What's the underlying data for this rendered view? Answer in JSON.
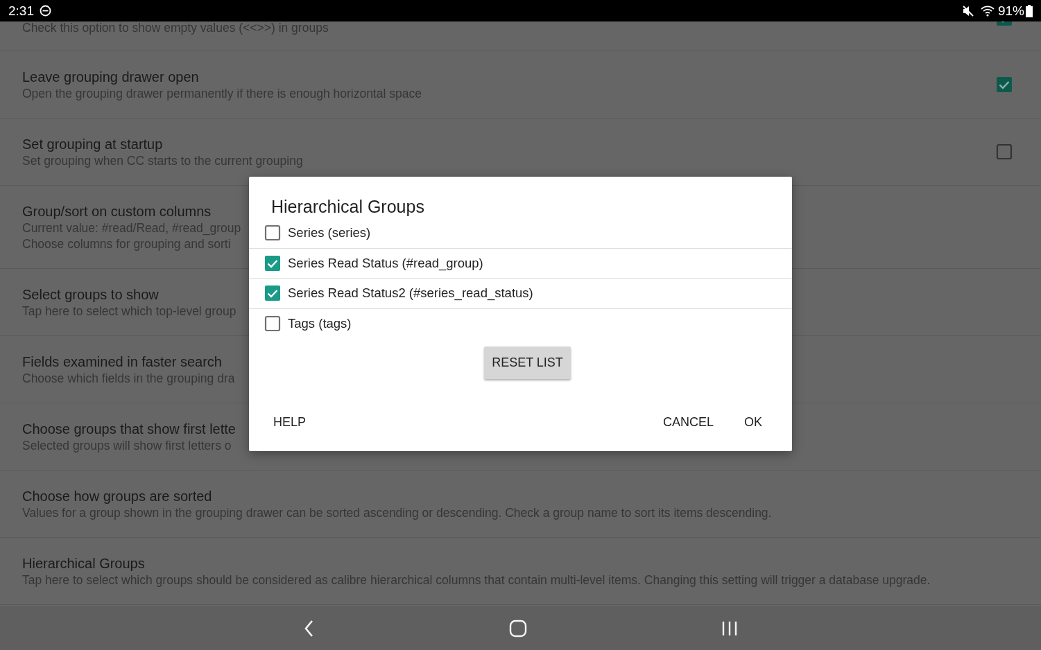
{
  "status_bar": {
    "time": "2:31",
    "battery": "91%"
  },
  "preferences": [
    {
      "kind": "checkbox",
      "summary": "Check this option to show empty values (<<>>) in groups",
      "checked": true
    },
    {
      "kind": "checkbox",
      "title": "Leave grouping drawer open",
      "summary": "Open the grouping drawer permanently if there is enough horizontal space",
      "checked": true
    },
    {
      "kind": "checkbox",
      "title": "Set grouping at startup",
      "summary": "Set grouping when CC starts to the current grouping",
      "checked": false
    },
    {
      "kind": "plain",
      "title": "Group/sort on custom columns",
      "summary": "Current value: #read/Read, #read_group",
      "summary_2": "Choose columns for grouping and sorti"
    },
    {
      "kind": "plain",
      "title": "Select groups to show",
      "summary": "Tap here to select which top-level group"
    },
    {
      "kind": "plain",
      "title": "Fields examined in faster search",
      "summary": "Choose which fields in the grouping dra"
    },
    {
      "kind": "plain",
      "title": "Choose groups that show first lette",
      "summary": "Selected groups will show first letters o"
    },
    {
      "kind": "plain",
      "title": "Choose how groups are sorted",
      "summary": "Values for a group shown in the grouping drawer can be sorted ascending or descending. Check a group name to sort its items descending."
    },
    {
      "kind": "plain",
      "title": "Hierarchical Groups",
      "summary": "Tap here to select which groups should be considered as calibre hierarchical columns that contain multi-level items. Changing this setting will trigger a database upgrade."
    }
  ],
  "dialog": {
    "title": "Hierarchical Groups",
    "items": [
      {
        "label": "Series (series)",
        "checked": false
      },
      {
        "label": "Series Read Status (#read_group)",
        "checked": true
      },
      {
        "label": "Series Read Status2 (#series_read_status)",
        "checked": true
      },
      {
        "label": "Tags (tags)",
        "checked": false
      }
    ],
    "reset_button": "RESET LIST",
    "help_button": "HELP",
    "cancel_button": "CANCEL",
    "ok_button": "OK"
  }
}
